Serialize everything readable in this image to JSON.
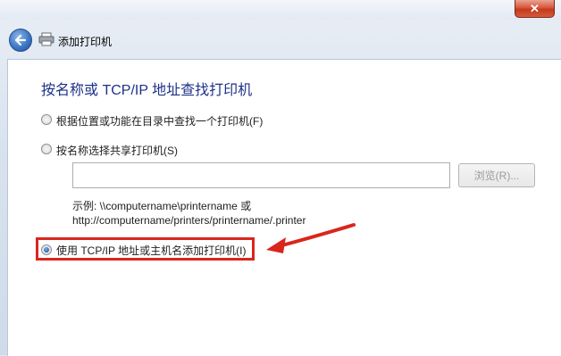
{
  "window": {
    "close_label": "✕",
    "title": "添加打印机"
  },
  "nav": {
    "back_icon": "back-arrow-icon",
    "printer_icon": "printer-icon"
  },
  "main": {
    "heading": "按名称或 TCP/IP 地址查找打印机",
    "options": [
      {
        "label": "根据位置或功能在目录中查找一个打印机(F)",
        "checked": false
      },
      {
        "label": "按名称选择共享打印机(S)",
        "checked": false
      },
      {
        "label": "使用 TCP/IP 地址或主机名添加打印机(I)",
        "checked": true
      }
    ],
    "share_input": {
      "value": "",
      "placeholder": ""
    },
    "browse_label": "浏览(R)...",
    "example_line1": "示例: \\\\computername\\printername 或",
    "example_line2": "http://computername/printers/printername/.printer"
  },
  "annotation": {
    "highlight_color": "#d9261c"
  }
}
